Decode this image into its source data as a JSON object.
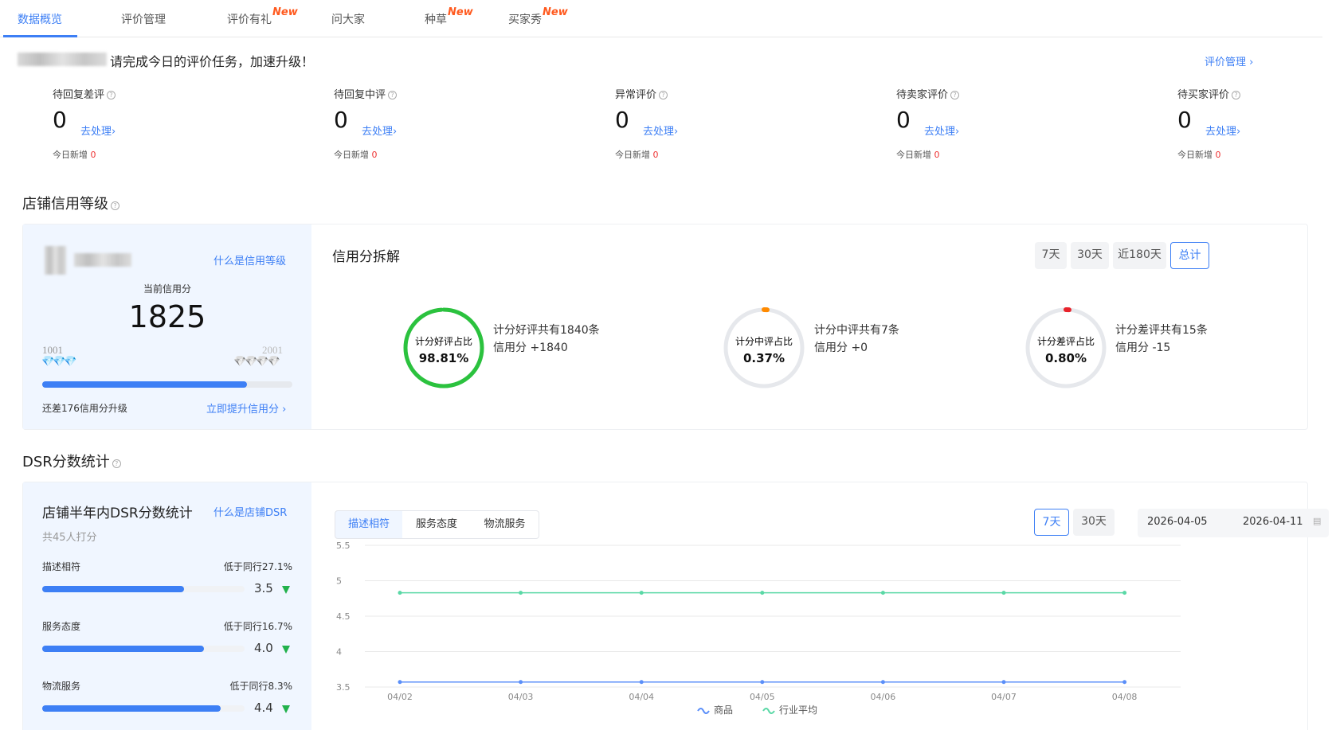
{
  "tabs": [
    {
      "label": "数据概览",
      "active": true,
      "new": ""
    },
    {
      "label": "评价管理",
      "active": false,
      "new": ""
    },
    {
      "label": "评价有礼",
      "active": false,
      "new": "New"
    },
    {
      "label": "问大家",
      "active": false,
      "new": ""
    },
    {
      "label": "种草",
      "active": false,
      "new": "New"
    },
    {
      "label": "买家秀",
      "active": false,
      "new": "New"
    }
  ],
  "banner": {
    "text": "请完成今日的评价任务，加速升级！",
    "manage_link": "评价管理 ›"
  },
  "metrics": [
    {
      "label": "待回复差评",
      "value": "0",
      "action": "去处理›",
      "today_label": "今日新增",
      "today_value": "0"
    },
    {
      "label": "待回复中评",
      "value": "0",
      "action": "去处理›",
      "today_label": "今日新增",
      "today_value": "0"
    },
    {
      "label": "异常评价",
      "value": "0",
      "action": "去处理›",
      "today_label": "今日新增",
      "today_value": "0"
    },
    {
      "label": "待卖家评价",
      "value": "0",
      "action": "去处理›",
      "today_label": "今日新增",
      "today_value": "0"
    },
    {
      "label": "待买家评价",
      "value": "0",
      "action": "去处理›",
      "today_label": "今日新增",
      "today_value": "0"
    }
  ],
  "credit": {
    "section_title": "店铺信用等级",
    "what_link": "什么是信用等级",
    "current_label": "当前信用分",
    "current_score": "1825",
    "range_min": "1001",
    "range_max": "2001",
    "progress": 0.82,
    "remaining": "还差176信用分升级",
    "upgrade_link": "立即提升信用分 ›",
    "breakdown_title": "信用分拆解",
    "ranges": [
      "7天",
      "30天",
      "近180天",
      "总计"
    ],
    "active_range": "总计",
    "rings": [
      {
        "label": "计分好评占比",
        "percent": "98.81%",
        "ratio": 0.9881,
        "color": "#2bc23e",
        "desc1": "计分好评共有1840条",
        "desc2": "信用分 +1840"
      },
      {
        "label": "计分中评占比",
        "percent": "0.37%",
        "ratio": 0.0037,
        "color": "#ff8a00",
        "desc1": "计分中评共有7条",
        "desc2": "信用分 +0"
      },
      {
        "label": "计分差评占比",
        "percent": "0.80%",
        "ratio": 0.008,
        "color": "#e8232b",
        "desc1": "计分差评共有15条",
        "desc2": "信用分 -15"
      }
    ]
  },
  "dsr": {
    "section_title": "DSR分数统计",
    "card_title": "店铺半年内DSR分数统计",
    "what_link": "什么是店铺DSR",
    "raters": "共45人打分",
    "rows": [
      {
        "label": "描述相符",
        "compare": "低于同行27.1%",
        "value": "3.5",
        "ratio": 0.7
      },
      {
        "label": "服务态度",
        "compare": "低于同行16.7%",
        "value": "4.0",
        "ratio": 0.8
      },
      {
        "label": "物流服务",
        "compare": "低于同行8.3%",
        "value": "4.4",
        "ratio": 0.88
      }
    ],
    "segments": [
      "描述相符",
      "服务态度",
      "物流服务"
    ],
    "active_segment": "描述相符",
    "ranges": [
      "7天",
      "30天"
    ],
    "active_range": "7天",
    "date_start": "2026-04-05",
    "date_end": "2026-04-11"
  },
  "chart_data": {
    "type": "line",
    "x": [
      "04/02",
      "04/03",
      "04/04",
      "04/05",
      "04/06",
      "04/07",
      "04/08"
    ],
    "ylim": [
      3.5,
      5.5
    ],
    "yticks": [
      "5.5",
      "5",
      "4.5",
      "4",
      "3.5"
    ],
    "grid": true,
    "legend": "bottom-center",
    "series": [
      {
        "name": "商品",
        "color": "#5b8ff9",
        "values": [
          3.57,
          3.57,
          3.57,
          3.57,
          3.57,
          3.57,
          3.57
        ]
      },
      {
        "name": "行业平均",
        "color": "#5ad8a6",
        "values": [
          4.83,
          4.83,
          4.83,
          4.83,
          4.83,
          4.83,
          4.83
        ]
      }
    ]
  }
}
